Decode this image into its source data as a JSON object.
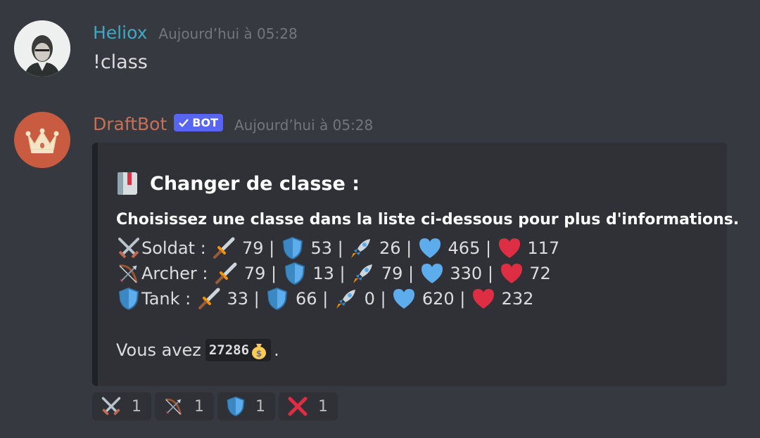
{
  "messages": [
    {
      "username": "Heliox",
      "timestamp": "Aujourd’hui à 05:28",
      "content": "!class"
    },
    {
      "username": "DraftBot",
      "bot_tag": "BOT",
      "timestamp": "Aujourd’hui à 05:28",
      "embed": {
        "title": "Changer de classe :",
        "description": "Choisissez une classe dans la liste ci-dessous pour plus d'informations.",
        "classes": [
          {
            "icon": "crossed-swords-icon",
            "name": "Soldat :",
            "attack": "79",
            "defense": "53",
            "speed": "26",
            "max_health": "465",
            "health": "117"
          },
          {
            "icon": "bow-and-arrow-icon",
            "name": "Archer :",
            "attack": "79",
            "defense": "13",
            "speed": "79",
            "max_health": "330",
            "health": "72"
          },
          {
            "icon": "shield-icon",
            "name": "Tank :",
            "attack": "33",
            "defense": "66",
            "speed": "0",
            "max_health": "620",
            "health": "232"
          }
        ],
        "money_prefix": "Vous avez",
        "money_value": "27286",
        "money_suffix": "."
      }
    }
  ],
  "reactions": [
    {
      "icon": "crossed-swords-icon",
      "count": "1"
    },
    {
      "icon": "bow-and-arrow-icon",
      "count": "1"
    },
    {
      "icon": "shield-icon",
      "count": "1"
    },
    {
      "icon": "red-x-icon",
      "count": "1"
    }
  ],
  "colors": {
    "background": "#36393f",
    "embed_background": "#2f3136",
    "user_name": "#3fa9c4",
    "bot_name": "#c96f55",
    "bot_tag": "#5865f2",
    "timestamp": "#72767d"
  }
}
